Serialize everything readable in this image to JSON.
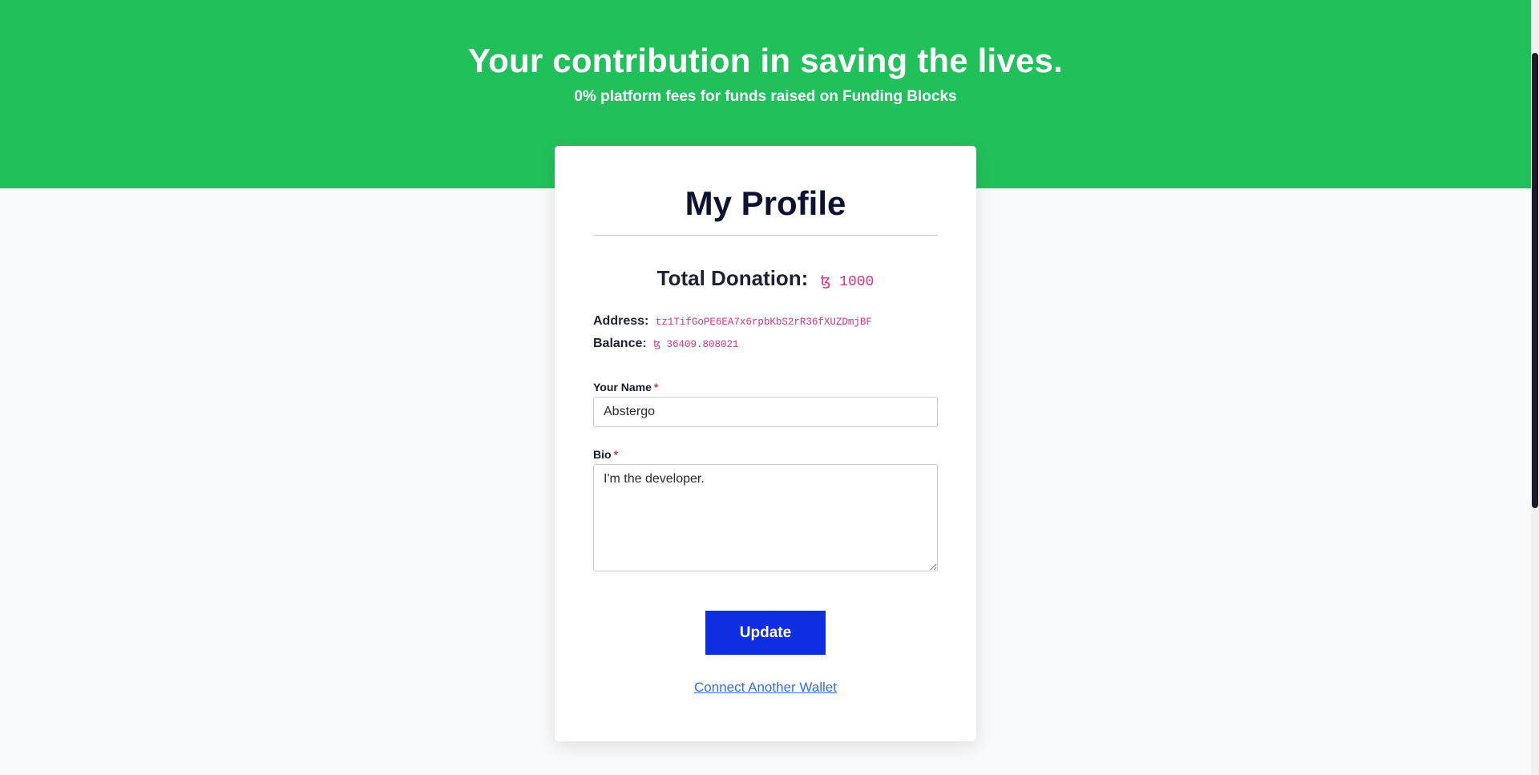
{
  "hero": {
    "title": "Your contribution in saving the lives.",
    "subtitle": "0% platform fees for funds raised on Funding Blocks",
    "background_color": "#21c05b"
  },
  "profile": {
    "title": "My Profile",
    "total_donation_label": "Total Donation:",
    "total_donation_value": "ꜩ 1000",
    "address_label": "Address:",
    "address_value": "tz1TifGoPE6EA7x6rpbKbS2rR36fXUZDmjBF",
    "balance_label": "Balance:",
    "balance_value": "ꜩ 36409.808021",
    "name_label": "Your Name",
    "name_value": "Abstergo",
    "bio_label": "Bio",
    "bio_value": "I'm the developer.",
    "required_mark": "*",
    "update_label": "Update",
    "connect_label": "Connect Another Wallet"
  },
  "colors": {
    "accent_button": "#0f2ee1",
    "link": "#2f6ef0",
    "mono_highlight": "#d63384",
    "required": "#dc3545"
  }
}
